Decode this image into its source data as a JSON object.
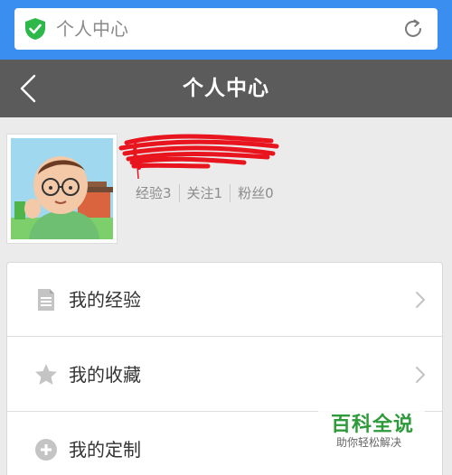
{
  "browser": {
    "address_text": "个人中心",
    "security_icon": "shield-check-icon",
    "reload_icon": "reload-icon",
    "accent": "#3a8ef0"
  },
  "header": {
    "title": "个人中心",
    "back_icon": "chevron-left-icon",
    "background": "#5b5b5b"
  },
  "profile": {
    "avatar": "avatar-cartoon",
    "username_redacted": true,
    "stats": [
      {
        "label": "经验3"
      },
      {
        "label": "关注1"
      },
      {
        "label": "粉丝0"
      }
    ]
  },
  "menu": {
    "items": [
      {
        "label": "我的经验",
        "icon": "document-icon"
      },
      {
        "label": "我的收藏",
        "icon": "star-icon"
      },
      {
        "label": "我的定制",
        "icon": "plus-circle-icon"
      }
    ]
  },
  "watermark": {
    "title": "百科全说",
    "subtitle": "助你轻松解决",
    "color": "#2e9a3a"
  }
}
